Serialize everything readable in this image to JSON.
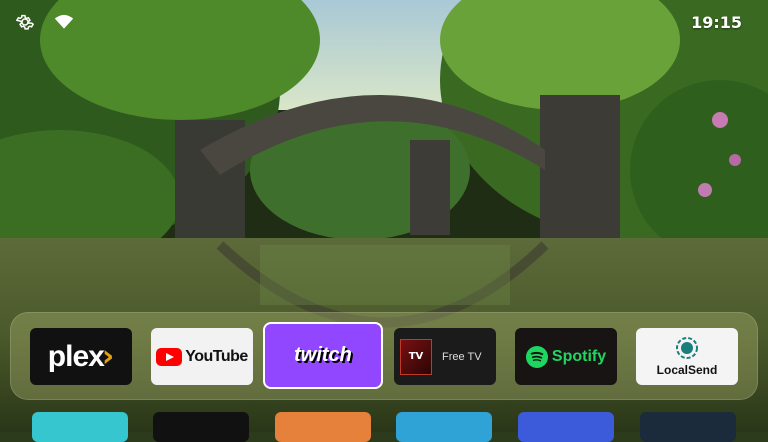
{
  "status_bar": {
    "clock": "19:15",
    "settings_icon": "gear-icon",
    "network_icon": "wifi-icon"
  },
  "apps": [
    {
      "name": "plex",
      "bg": "#111111",
      "accent": "#e5a00d"
    },
    {
      "name": "YouTube",
      "bg": "#f2f2f2",
      "accent": "#ff0000"
    },
    {
      "name": "twitch",
      "bg": "#9146ff",
      "accent": "#ffffff",
      "selected": true
    },
    {
      "name": "Free TV",
      "bg": "#1b1b1b",
      "accent": "#c0392b",
      "logo_text": "TV"
    },
    {
      "name": "Spotify",
      "bg": "#191414",
      "accent": "#1ed760"
    },
    {
      "name": "LocalSend",
      "bg": "#f4f4f4",
      "accent": "#1a7f7a"
    }
  ],
  "second_row_colors": [
    "#36c6cf",
    "#111111",
    "#e5813b",
    "#2fa3d6",
    "#3b5bdb",
    "#1b2b3b"
  ]
}
